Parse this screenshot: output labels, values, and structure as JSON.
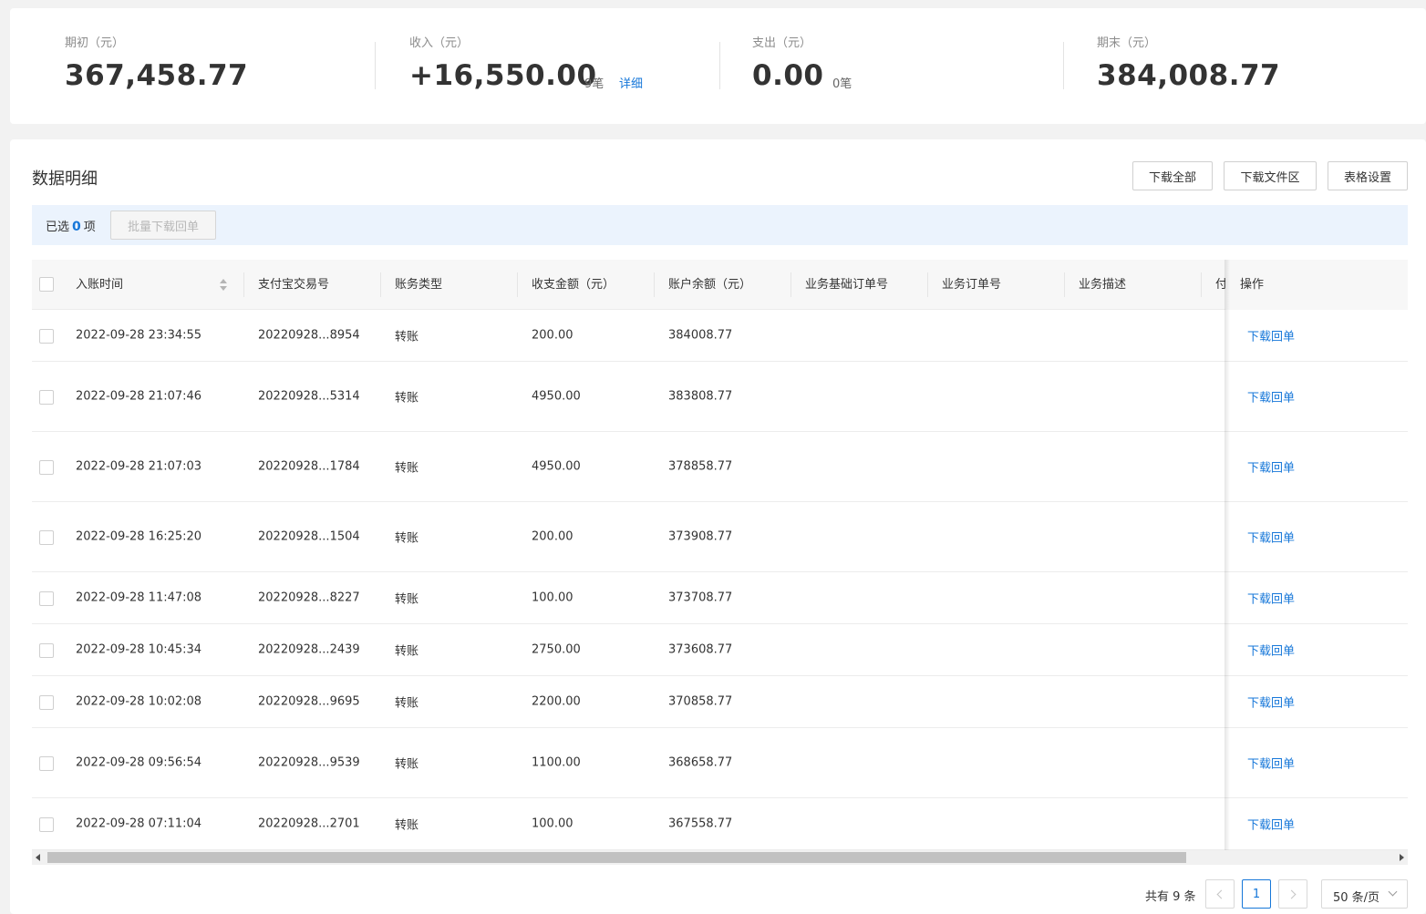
{
  "summary": {
    "opening": {
      "label": "期初（元）",
      "value": "367,458.77"
    },
    "income": {
      "label": "收入（元）",
      "value": "+16,550.00",
      "count": "9笔",
      "link": "详细"
    },
    "expense": {
      "label": "支出（元）",
      "value": "0.00",
      "count": "0笔"
    },
    "closing": {
      "label": "期末（元）",
      "value": "384,008.77"
    }
  },
  "detail": {
    "title": "数据明细",
    "buttons": {
      "download_all": "下载全部",
      "download_zone": "下载文件区",
      "table_settings": "表格设置"
    },
    "selection": {
      "prefix": "已选",
      "count": "0",
      "suffix": "项",
      "batch_button": "批量下载回单"
    }
  },
  "table": {
    "columns": [
      "入账时间",
      "支付宝交易号",
      "账务类型",
      "收支金额（元）",
      "账户余额（元）",
      "业务基础订单号",
      "业务订单号",
      "业务描述",
      "付",
      "操作"
    ],
    "rows": [
      {
        "time": "2022-09-28 23:34:55",
        "tx": "20220928...8954",
        "type": "转账",
        "amount": "200.00",
        "balance": "384008.77",
        "action": "下载回单"
      },
      {
        "time": "2022-09-28 21:07:46",
        "tx": "20220928...5314",
        "type": "转账",
        "amount": "4950.00",
        "balance": "383808.77",
        "action": "下载回单"
      },
      {
        "time": "2022-09-28 21:07:03",
        "tx": "20220928...1784",
        "type": "转账",
        "amount": "4950.00",
        "balance": "378858.77",
        "action": "下载回单"
      },
      {
        "time": "2022-09-28 16:25:20",
        "tx": "20220928...1504",
        "type": "转账",
        "amount": "200.00",
        "balance": "373908.77",
        "action": "下载回单"
      },
      {
        "time": "2022-09-28 11:47:08",
        "tx": "20220928...8227",
        "type": "转账",
        "amount": "100.00",
        "balance": "373708.77",
        "action": "下载回单"
      },
      {
        "time": "2022-09-28 10:45:34",
        "tx": "20220928...2439",
        "type": "转账",
        "amount": "2750.00",
        "balance": "373608.77",
        "action": "下载回单"
      },
      {
        "time": "2022-09-28 10:02:08",
        "tx": "20220928...9695",
        "type": "转账",
        "amount": "2200.00",
        "balance": "370858.77",
        "action": "下载回单"
      },
      {
        "time": "2022-09-28 09:56:54",
        "tx": "20220928...9539",
        "type": "转账",
        "amount": "1100.00",
        "balance": "368658.77",
        "action": "下载回单"
      },
      {
        "time": "2022-09-28 07:11:04",
        "tx": "20220928...2701",
        "type": "转账",
        "amount": "100.00",
        "balance": "367558.77",
        "action": "下载回单"
      }
    ]
  },
  "pagination": {
    "total": "共有 9 条",
    "current_page": "1",
    "page_size": "50 条/页"
  },
  "colors": {
    "accent": "#1677d9",
    "selection_bg": "#ebf3fd"
  }
}
